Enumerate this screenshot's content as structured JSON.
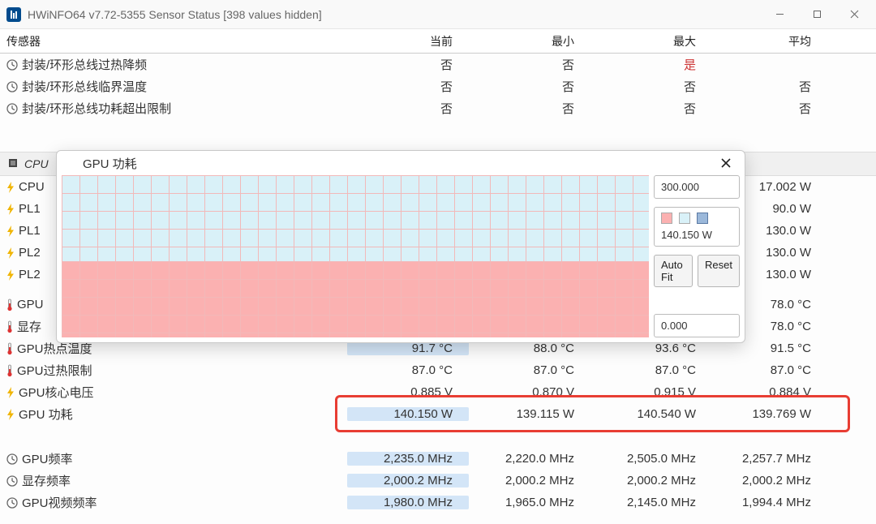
{
  "window": {
    "title": "HWiNFO64 v7.72-5355 Sensor Status [398 values hidden]"
  },
  "headers": {
    "sensor": "传感器",
    "current": "当前",
    "min": "最小",
    "max": "最大",
    "avg": "平均"
  },
  "thermal_rows": [
    {
      "name": "封装/环形总线过热降频",
      "cur": "否",
      "min": "否",
      "max": "是",
      "avg": "",
      "max_red": true
    },
    {
      "name": "封装/环形总线临界温度",
      "cur": "否",
      "min": "否",
      "max": "否",
      "avg": "否"
    },
    {
      "name": "封装/环形总线功耗超出限制",
      "cur": "否",
      "min": "否",
      "max": "否",
      "avg": "否"
    }
  ],
  "group_cpu": "CPU",
  "power_rows_left": [
    {
      "name": "CPU"
    },
    {
      "name": "PL1"
    },
    {
      "name": "PL1"
    },
    {
      "name": "PL2"
    },
    {
      "name": "PL2"
    }
  ],
  "power_rows_right": [
    "17.002 W",
    "90.0 W",
    "130.0 W",
    "130.0 W",
    "130.0 W"
  ],
  "gpu_rows_hidden": [
    {
      "name": "GPU",
      "avg": "78.0 °C"
    },
    {
      "name": "显存",
      "avg": "78.0 °C"
    }
  ],
  "gpu_rows": [
    {
      "name": "GPU热点温度",
      "cur": "91.7 °C",
      "min": "88.0 °C",
      "max": "93.6 °C",
      "avg": "91.5 °C",
      "hi": true,
      "icon": "therm"
    },
    {
      "name": "GPU过热限制",
      "cur": "87.0 °C",
      "min": "87.0 °C",
      "max": "87.0 °C",
      "avg": "87.0 °C",
      "icon": "therm"
    },
    {
      "name": "GPU核心电压",
      "cur": "0.885 V",
      "min": "0.870 V",
      "max": "0.915 V",
      "avg": "0.884 V",
      "icon": "bolt"
    },
    {
      "name": "GPU 功耗",
      "cur": "140.150 W",
      "min": "139.115 W",
      "max": "140.540 W",
      "avg": "139.769 W",
      "hi": true,
      "icon": "bolt"
    }
  ],
  "freq_rows": [
    {
      "name": "GPU频率",
      "cur": "2,235.0 MHz",
      "min": "2,220.0 MHz",
      "max": "2,505.0 MHz",
      "avg": "2,257.7 MHz",
      "hi": true
    },
    {
      "name": "显存频率",
      "cur": "2,000.2 MHz",
      "min": "2,000.2 MHz",
      "max": "2,000.2 MHz",
      "avg": "2,000.2 MHz",
      "hi": true
    },
    {
      "name": "GPU视频频率",
      "cur": "1,980.0 MHz",
      "min": "1,965.0 MHz",
      "max": "2,145.0 MHz",
      "avg": "1,994.4 MHz",
      "hi": true
    }
  ],
  "popup": {
    "title": "GPU 功耗",
    "ymax": "300.000",
    "yval": "140.150 W",
    "ymin": "0.000",
    "autofit": "Auto Fit",
    "reset": "Reset"
  },
  "chart_data": {
    "type": "area",
    "title": "GPU 功耗",
    "ylabel": "W",
    "ylim": [
      0,
      300
    ],
    "series": [
      {
        "name": "GPU 功耗",
        "color": "#fbb1b1",
        "values": [
          140.15,
          140.15,
          140.15,
          140.15,
          140.15,
          140.15,
          140.15,
          140.15,
          140.15,
          140.15
        ]
      }
    ]
  }
}
